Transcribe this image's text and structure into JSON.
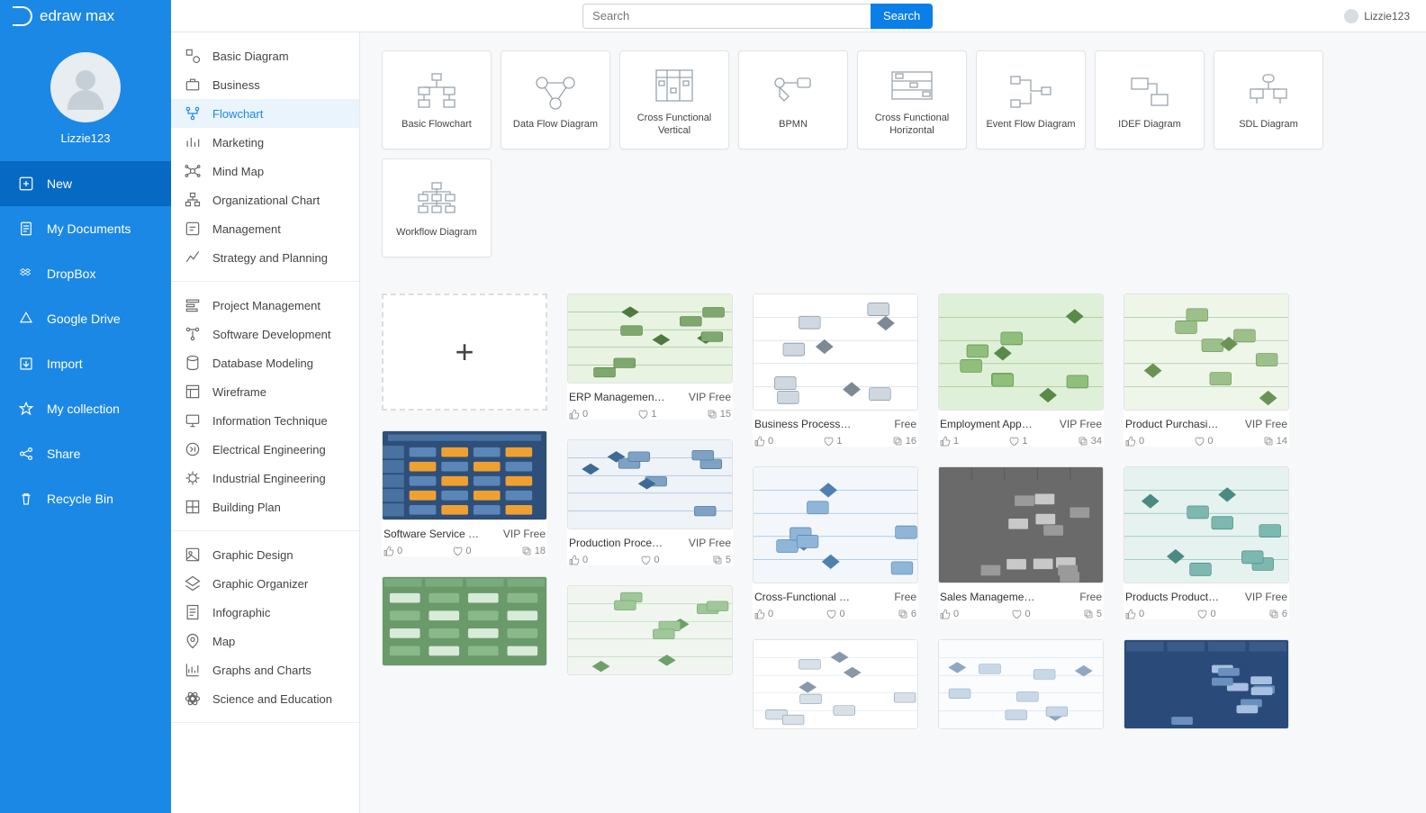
{
  "brand": "edraw max",
  "search": {
    "placeholder": "Search",
    "button": "Search"
  },
  "topUser": "Lizzie123",
  "profileName": "Lizzie123",
  "leftNav": [
    {
      "key": "new",
      "label": "New",
      "active": true
    },
    {
      "key": "mydocs",
      "label": "My Documents"
    },
    {
      "key": "dropbox",
      "label": "DropBox"
    },
    {
      "key": "gdrive",
      "label": "Google Drive"
    },
    {
      "key": "import",
      "label": "Import"
    },
    {
      "key": "collection",
      "label": "My collection"
    },
    {
      "key": "share",
      "label": "Share"
    },
    {
      "key": "recycle",
      "label": "Recycle Bin"
    }
  ],
  "catGroups": [
    {
      "items": [
        {
          "key": "basic",
          "label": "Basic Diagram"
        },
        {
          "key": "business",
          "label": "Business"
        },
        {
          "key": "flowchart",
          "label": "Flowchart",
          "selected": true
        },
        {
          "key": "marketing",
          "label": "Marketing"
        },
        {
          "key": "mindmap",
          "label": "Mind Map"
        },
        {
          "key": "orgchart",
          "label": "Organizational Chart"
        },
        {
          "key": "management",
          "label": "Management"
        },
        {
          "key": "strategy",
          "label": "Strategy and Planning"
        }
      ]
    },
    {
      "items": [
        {
          "key": "projmgmt",
          "label": "Project Management"
        },
        {
          "key": "softdev",
          "label": "Software Development"
        },
        {
          "key": "dbmodel",
          "label": "Database Modeling"
        },
        {
          "key": "wireframe",
          "label": "Wireframe"
        },
        {
          "key": "infotech",
          "label": "Information Technique"
        },
        {
          "key": "eleceng",
          "label": "Electrical Engineering"
        },
        {
          "key": "indeng",
          "label": "Industrial Engineering"
        },
        {
          "key": "buildplan",
          "label": "Building Plan"
        }
      ]
    },
    {
      "items": [
        {
          "key": "graphicdesign",
          "label": "Graphic Design"
        },
        {
          "key": "graphicorg",
          "label": "Graphic Organizer"
        },
        {
          "key": "infographic",
          "label": "Infographic"
        },
        {
          "key": "map",
          "label": "Map"
        },
        {
          "key": "graphs",
          "label": "Graphs and Charts"
        },
        {
          "key": "sciedu",
          "label": "Science and Education"
        }
      ]
    }
  ],
  "types": [
    {
      "label": "Basic Flowchart"
    },
    {
      "label": "Data Flow Diagram"
    },
    {
      "label": "Cross Functional Vertical"
    },
    {
      "label": "BPMN"
    },
    {
      "label": "Cross Functional Horizontal"
    },
    {
      "label": "Event Flow Diagram"
    },
    {
      "label": "IDEF Diagram"
    },
    {
      "label": "SDL Diagram"
    },
    {
      "label": "Workflow Diagram"
    }
  ],
  "templates": {
    "col0": [
      {
        "kind": "new"
      },
      {
        "title": "Software Service …",
        "tag": "VIP Free",
        "likes": 0,
        "favs": 0,
        "copies": 18,
        "thumb": "blueorange"
      },
      {
        "title": "",
        "tag": "",
        "thumbOnly": true,
        "thumb": "greenlanes"
      }
    ],
    "col1": [
      {
        "title": "ERP Managemen…",
        "tag": "VIP Free",
        "likes": 0,
        "favs": 1,
        "copies": 15,
        "thumb": "bpmn-green"
      },
      {
        "title": "Production Proce…",
        "tag": "VIP Free",
        "likes": 0,
        "favs": 0,
        "copies": 5,
        "thumb": "blue-flow"
      },
      {
        "title": "",
        "tag": "",
        "thumbOnly": true,
        "thumb": "green-lite"
      }
    ],
    "col2": [
      {
        "title": "Business Process Mo…",
        "tag": "Free",
        "likes": 0,
        "favs": 1,
        "copies": 16,
        "thumb": "bpmn-plain",
        "tall": true
      },
      {
        "title": "Cross-Functional Flo…",
        "tag": "Free",
        "likes": 0,
        "favs": 0,
        "copies": 6,
        "thumb": "cross-blue",
        "tall": true
      },
      {
        "title": "",
        "tag": "",
        "thumbOnly": true,
        "thumb": "plain-boxes"
      }
    ],
    "col3": [
      {
        "title": "Employment App…",
        "tag": "VIP Free",
        "likes": 1,
        "favs": 1,
        "copies": 34,
        "thumb": "green-grid",
        "tall": true
      },
      {
        "title": "Sales Management C…",
        "tag": "Free",
        "likes": 0,
        "favs": 0,
        "copies": 5,
        "thumb": "gray-lanes",
        "tall": true
      },
      {
        "title": "",
        "tag": "",
        "thumbOnly": true,
        "thumb": "pale-flow"
      }
    ],
    "col4": [
      {
        "title": "Product Purchasi…",
        "tag": "VIP Free",
        "likes": 0,
        "favs": 0,
        "copies": 14,
        "thumb": "green-decision",
        "tall": true
      },
      {
        "title": "Products Product…",
        "tag": "VIP Free",
        "likes": 0,
        "favs": 0,
        "copies": 6,
        "thumb": "teal-lanes",
        "tall": true
      },
      {
        "title": "",
        "tag": "",
        "thumbOnly": true,
        "thumb": "blue-dark"
      }
    ]
  }
}
